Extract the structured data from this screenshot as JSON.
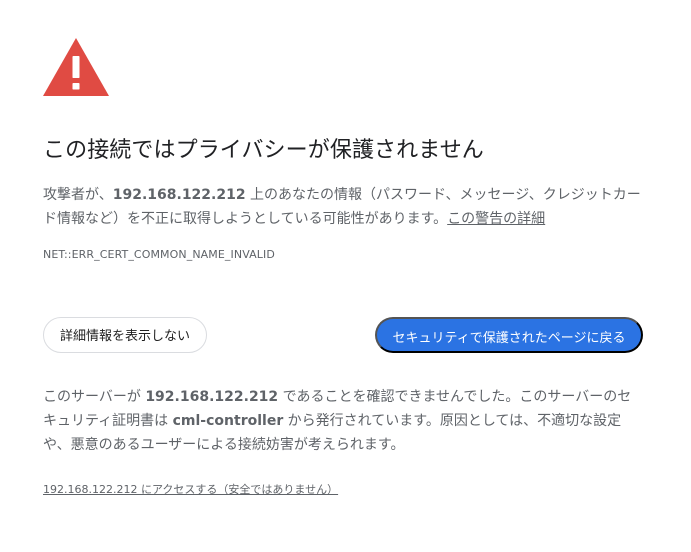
{
  "icon": {
    "name": "warning-triangle-icon",
    "color": "#e04b43"
  },
  "main": {
    "title": "この接続ではプライバシーが保護されません",
    "summary": {
      "before_host": "攻撃者が、",
      "host": "192.168.122.212",
      "after_host": " 上のあなたの情報（パスワード、メッセージ、クレジットカード情報など）を不正に取得しようとしている可能性があります。",
      "details_link": "この警告の詳細"
    },
    "error_code": "NET::ERR_CERT_COMMON_NAME_INVALID"
  },
  "buttons": {
    "secondary": "詳細情報を表示しない",
    "primary": "セキュリティで保護されたページに戻る"
  },
  "details": {
    "before_host": "このサーバーが ",
    "host": "192.168.122.212",
    "after_host": " であることを確認できませんでした。このサーバーのセキュリティ証明書は ",
    "cert_name": "cml-controller",
    "after_cert": " から発行されています。原因としては、不適切な設定や、悪意のあるユーザーによる接続妨害が考えられます。",
    "proceed_link": "192.168.122.212 にアクセスする（安全ではありません）"
  },
  "colors": {
    "accent": "#2b73e3",
    "warning": "#e04b43",
    "text": "#202124",
    "secondary_text": "#5f6368",
    "border": "#dadce0"
  }
}
